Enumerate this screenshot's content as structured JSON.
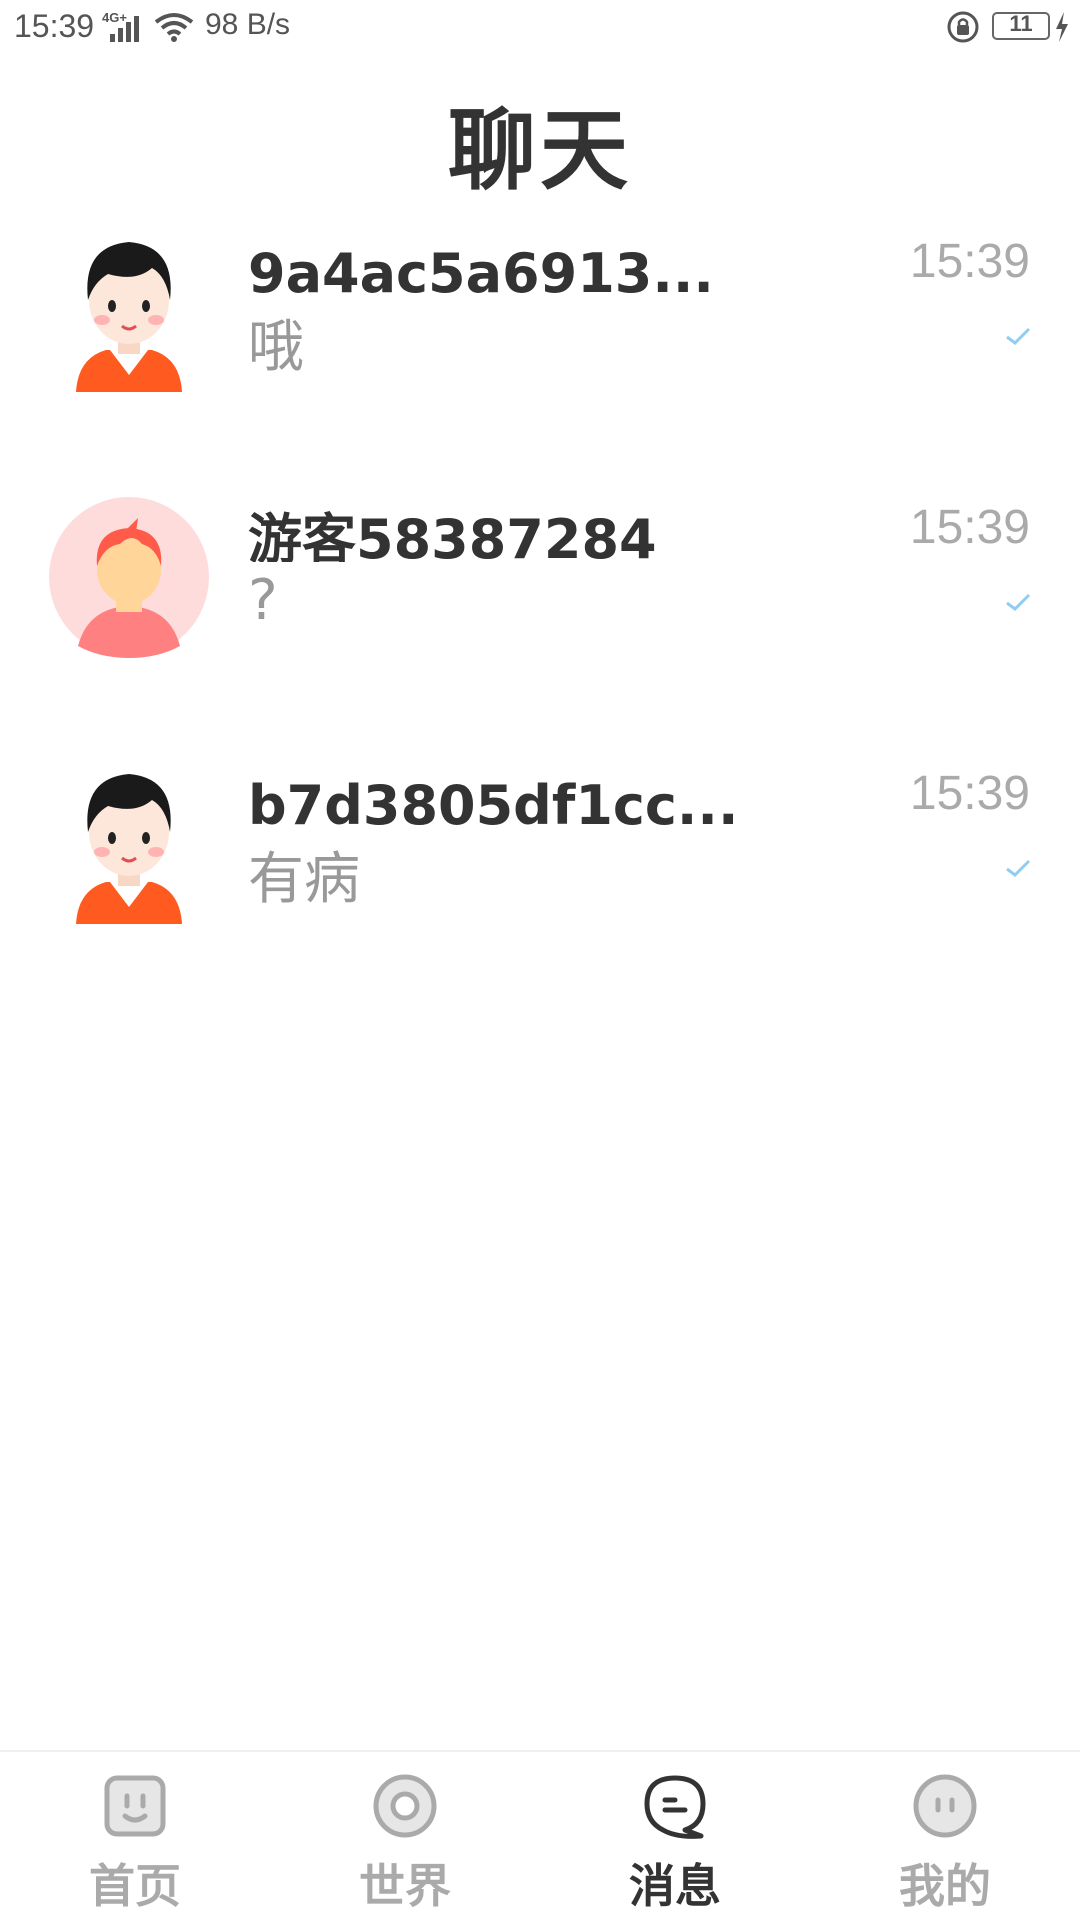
{
  "status_bar": {
    "time": "15:39",
    "network": "4G+",
    "speed": "98 B/s",
    "battery": "11"
  },
  "header": {
    "title": "聊天"
  },
  "chats": [
    {
      "name": "9a4ac5a6913...",
      "last_message": "哦",
      "time": "15:39",
      "avatar": "boy-avatar"
    },
    {
      "name": "游客58387284",
      "last_message": "?",
      "time": "15:39",
      "avatar": "guest-avatar"
    },
    {
      "name": "b7d3805df1cc...",
      "last_message": "有病",
      "time": "15:39",
      "avatar": "boy-avatar"
    }
  ],
  "bottom_nav": {
    "items": [
      {
        "label": "首页",
        "icon": "home-face-icon",
        "active": false
      },
      {
        "label": "世界",
        "icon": "world-circle-icon",
        "active": false
      },
      {
        "label": "消息",
        "icon": "message-bubble-icon",
        "active": true
      },
      {
        "label": "我的",
        "icon": "profile-face-icon",
        "active": false
      }
    ]
  },
  "colors": {
    "text_primary": "#333333",
    "text_secondary": "#999999",
    "check": "#90cdf4",
    "avatar_accent": "#ff5a1f"
  }
}
